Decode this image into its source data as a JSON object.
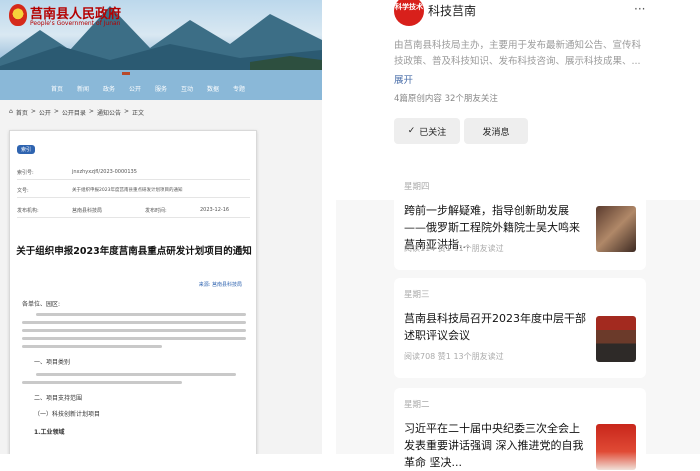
{
  "left": {
    "site_title": "莒南县人民政府",
    "site_subtitle": "People's Government of Junan",
    "nav": [
      "首页",
      "新闻",
      "政务",
      "公开",
      "服务",
      "互动",
      "数据",
      "专题"
    ],
    "breadcrumb": [
      "首页",
      "公开",
      "公开目录",
      "通知公告",
      "正文"
    ],
    "badge": "索引",
    "meta": [
      {
        "key": "索引号:",
        "value": "jnxzhyxzjfl/2023-0000135"
      },
      {
        "key": "文号:",
        "value": "关于组织申报2023年度莒南县重点研发计划项目的通知"
      },
      {
        "key": "发布机构:",
        "value": "莒南县科技局"
      },
      {
        "key": "发布时间:",
        "value": "2023-12-16"
      }
    ],
    "doc_title": "关于组织申报2023年度莒南县重点研发计划项目的通知",
    "doc_source": "来源: 莒南县科技局",
    "greeting": "各单位、园区:",
    "section1": "一、项目类别",
    "section2": "二、项目支持范围",
    "section3": "（一）科技创新计划项目",
    "section4": "1.工业领域"
  },
  "right": {
    "logo_text": "科学技术",
    "account_name": "科技莒南",
    "more_icon": "more-icon",
    "description": "由莒南县科技局主办，主要用于发布最新通知公告、宣传科技政策、普及科技知识、发布科技咨询、展示科技成果、...",
    "expand": "展开",
    "stats": "4篇原创内容  32个朋友关注",
    "followed_label": "已关注",
    "message_label": "发消息",
    "articles": [
      {
        "day": "星期四",
        "title": "跨前一步解疑难，指导创新助发展——俄罗斯工程院外籍院士吴大鸣来莒南亚洪指...",
        "info": "阅读114  赞1  11个朋友读过",
        "thumb_color": "#7a4a3a"
      },
      {
        "day": "星期三",
        "title": "莒南县科技局召开2023年度中层干部述职评议会议",
        "info": "阅读708  赞1  13个朋友读过",
        "thumb_color": "#9a2a1e"
      },
      {
        "day": "星期二",
        "title": "习近平在二十届中央纪委三次全会上发表重要讲话强调 深入推进党的自我革命 坚决...",
        "info": "",
        "thumb_color": "#c4211a"
      }
    ]
  }
}
